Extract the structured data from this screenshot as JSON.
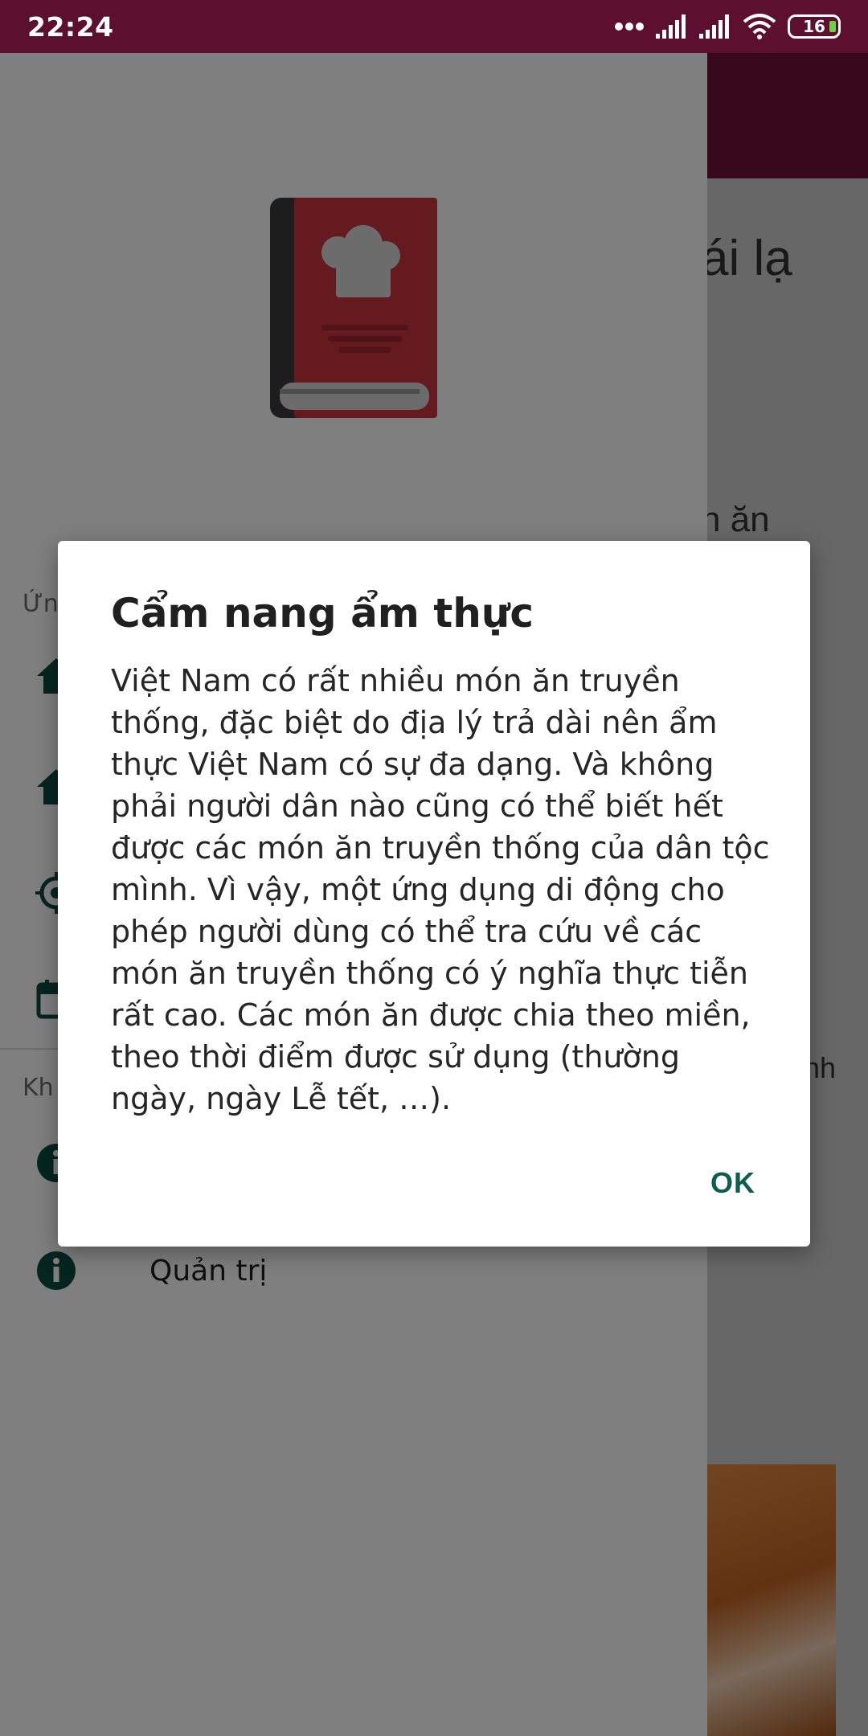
{
  "status_bar": {
    "time": "22:24",
    "battery": "16",
    "icons": [
      "more-dots-icon",
      "signal-icon",
      "signal-icon",
      "wifi-icon",
      "battery-icon"
    ]
  },
  "background_app": {
    "title_fragment": "ái lạ",
    "text_fragment_1": "n ăn",
    "text_fragment_2": "nh",
    "accent_color": "#6e1237"
  },
  "drawer": {
    "logo_icon": "recipe-book-icon",
    "section_1": "Ứn",
    "section_2": "Kh",
    "items": [
      {
        "icon": "home-icon",
        "label": ""
      },
      {
        "icon": "home-icon",
        "label": ""
      },
      {
        "icon": "target-icon",
        "label": ""
      },
      {
        "icon": "calendar-icon",
        "label": ""
      },
      {
        "icon": "info-icon",
        "label": ""
      },
      {
        "icon": "info-icon",
        "label": "Quản trị"
      }
    ],
    "icon_color": "#0d4b3f"
  },
  "dialog": {
    "title": "Cẩm nang ẩm thực",
    "message": "Việt Nam có rất nhiều món ăn truyền thống, đặc biệt do địa lý trả dài nên ẩm thực Việt Nam có sự đa dạng. Và không phải người dân nào cũng có thể biết hết được các món ăn truyền thống của dân tộc mình. Vì vậy, một ứng dụng di động cho phép người dùng có thể tra cứu về các món ăn truyền thống có ý nghĩa thực tiễn rất cao. Các món ăn được chia theo miền, theo thời điểm được sử dụng (thường ngày, ngày Lễ tết, …).",
    "ok_label": "OK",
    "ok_color": "#0f5d52"
  }
}
